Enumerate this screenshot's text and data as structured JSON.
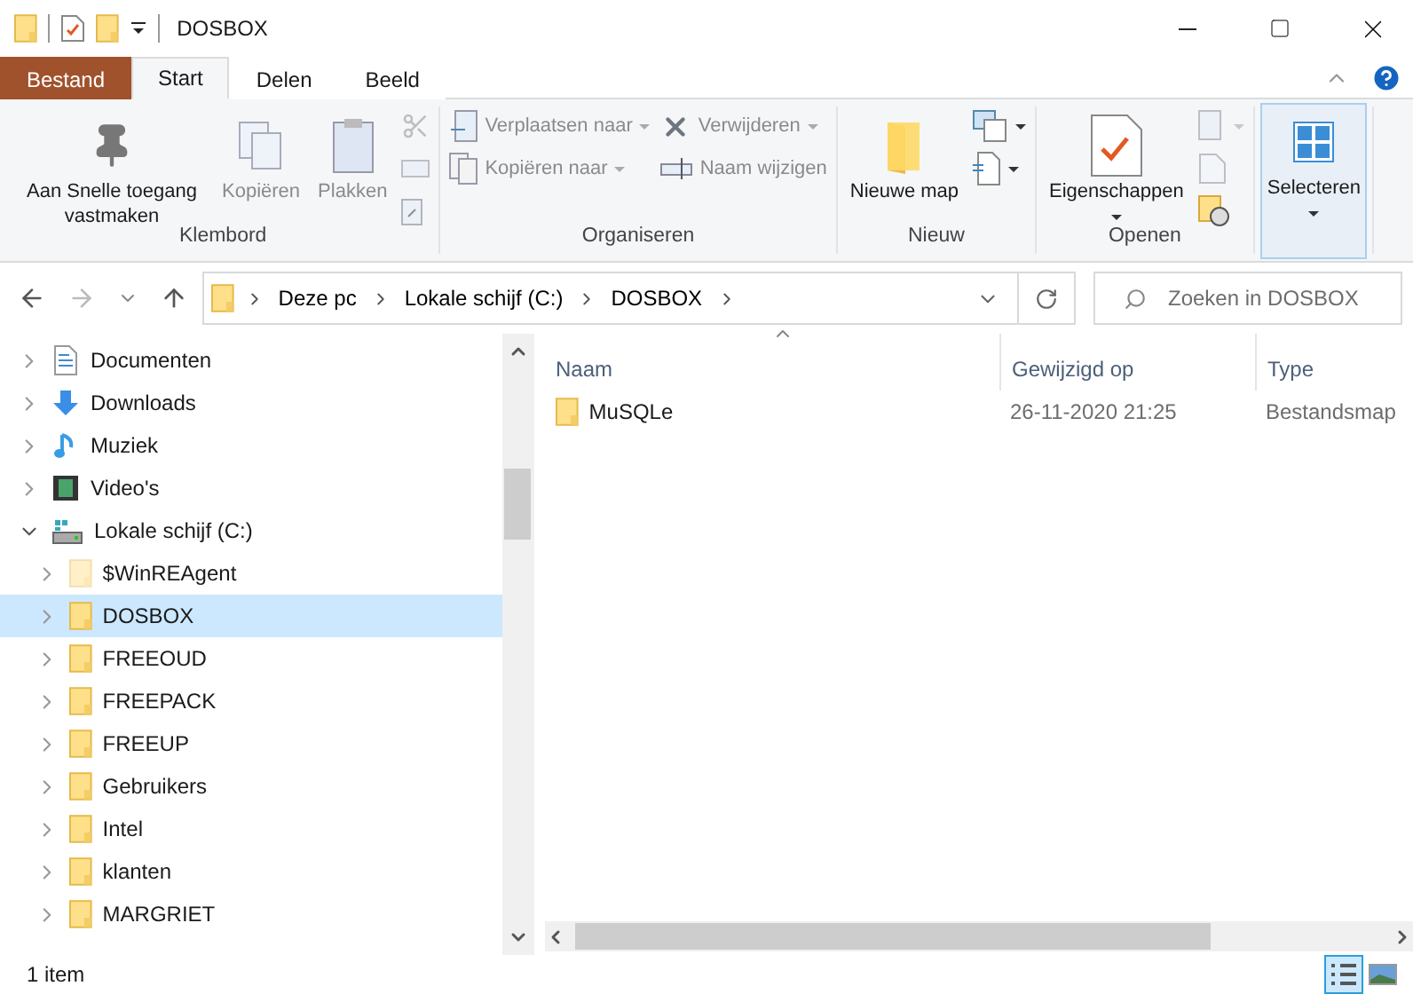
{
  "window": {
    "title": "DOSBOX"
  },
  "ribbon_tabs": [
    {
      "label": "Bestand",
      "kind": "file",
      "selected": false
    },
    {
      "label": "Start",
      "kind": "tab",
      "selected": true
    },
    {
      "label": "Delen",
      "kind": "tab",
      "selected": false
    },
    {
      "label": "Beeld",
      "kind": "tab",
      "selected": false
    }
  ],
  "ribbon_groups": [
    {
      "label": "Klembord",
      "items": [
        {
          "kind": "large",
          "label": "Aan Snelle toegang vastmaken",
          "disabled": false,
          "highlighted": false
        },
        {
          "kind": "large",
          "label": "Kopiëren",
          "disabled": true,
          "highlighted": false
        },
        {
          "kind": "large",
          "label": "Plakken",
          "disabled": true,
          "highlighted": false
        },
        {
          "kind": "stack",
          "buttons": [
            {
              "disabled": true
            },
            {
              "disabled": true
            },
            {
              "disabled": true
            }
          ]
        }
      ]
    },
    {
      "label": "Organiseren",
      "items": [
        {
          "kind": "stack",
          "buttons": [
            {
              "label": "Verplaatsen naar",
              "disabled": true,
              "dropdown": true
            },
            {
              "label": "Kopiëren naar",
              "disabled": true,
              "dropdown": true
            }
          ]
        },
        {
          "kind": "stack",
          "buttons": [
            {
              "label": "Verwijderen",
              "disabled": true,
              "dropdown": true
            },
            {
              "label": "Naam wijzigen",
              "disabled": true
            }
          ]
        }
      ]
    },
    {
      "label": "Nieuw",
      "items": [
        {
          "kind": "large",
          "label": "Nieuwe map",
          "disabled": false,
          "highlighted": false
        },
        {
          "kind": "stack",
          "buttons": [
            {
              "disabled": false,
              "dropdown": true
            },
            {
              "disabled": false,
              "dropdown": true
            }
          ]
        }
      ]
    },
    {
      "label": "Openen",
      "items": [
        {
          "kind": "large",
          "label": "Eigenschappen",
          "disabled": false,
          "dropdown": true,
          "highlighted": false
        },
        {
          "kind": "stack",
          "buttons": [
            {
              "disabled": true,
              "dropdown": true
            },
            {
              "disabled": true
            },
            {
              "disabled": false
            }
          ]
        }
      ]
    },
    {
      "items": [
        {
          "kind": "large",
          "label": "Selecteren",
          "disabled": false,
          "dropdown": true,
          "highlighted": true
        }
      ]
    }
  ],
  "address_bar": {
    "crumbs": [
      "Deze pc",
      "Lokale schijf (C:)",
      "DOSBOX"
    ]
  },
  "search": {
    "placeholder": "Zoeken in DOSBOX"
  },
  "navigation": [
    {
      "label": "Documenten",
      "expanded": false,
      "selected": false
    },
    {
      "label": "Downloads",
      "expanded": false,
      "selected": false
    },
    {
      "label": "Muziek",
      "expanded": false,
      "selected": false
    },
    {
      "label": "Video's",
      "expanded": false,
      "selected": false
    },
    {
      "label": "Lokale schijf (C:)",
      "expanded": true,
      "selected": false,
      "children": [
        {
          "label": "$WinREAgent",
          "expanded": false,
          "selected": false,
          "hidden": true
        },
        {
          "label": "DOSBOX",
          "expanded": false,
          "selected": true,
          "hidden": false
        },
        {
          "label": "FREEOUD",
          "expanded": false,
          "selected": false,
          "hidden": false
        },
        {
          "label": "FREEPACK",
          "expanded": false,
          "selected": false,
          "hidden": false
        },
        {
          "label": "FREEUP",
          "expanded": false,
          "selected": false,
          "hidden": false
        },
        {
          "label": "Gebruikers",
          "expanded": false,
          "selected": false,
          "hidden": false
        },
        {
          "label": "Intel",
          "expanded": false,
          "selected": false,
          "hidden": false
        },
        {
          "label": "klanten",
          "expanded": false,
          "selected": false,
          "hidden": false
        },
        {
          "label": "MARGRIET",
          "expanded": false,
          "selected": false,
          "hidden": false
        }
      ]
    }
  ],
  "table": {
    "columns": [
      {
        "label": "Naam",
        "sorted": true
      },
      {
        "label": "Gewijzigd op",
        "sorted": false
      },
      {
        "label": "Type",
        "sorted": false
      }
    ],
    "rows": [
      {
        "cells": [
          "MuSQLe",
          "26-11-2020 21:25",
          "Bestandsmap"
        ],
        "selected": false
      }
    ]
  },
  "status_bar": {
    "count": "1 item",
    "views": [
      {
        "kind": "details",
        "selected": true
      },
      {
        "kind": "large_icons",
        "selected": false
      }
    ]
  }
}
